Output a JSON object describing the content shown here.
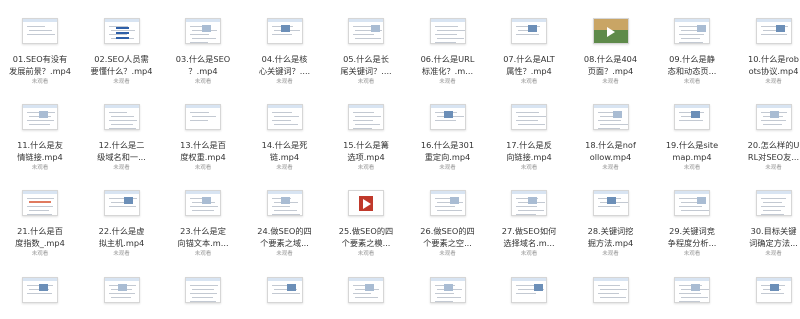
{
  "colors": {
    "title_text": "#333333",
    "status_text": "#999999",
    "background": "#ffffff"
  },
  "status_label": "未观看",
  "files": [
    {
      "title": "01.SEO有没有发展前景？.mp4",
      "title_lines": [
        "01.SEO有没有",
        "发展前景？.mp4"
      ],
      "icon": "document-thumbnail-icon"
    },
    {
      "title": "02.SEO人员需要懂什么？.mp4",
      "title_lines": [
        "02.SEO人员需",
        "要懂什么？.mp4"
      ],
      "icon": "document-thumbnail-icon"
    },
    {
      "title": "03.什么是SEO？.mp4",
      "title_lines": [
        "03.什么是SEO",
        "？.mp4"
      ],
      "icon": "webpage-thumbnail-icon"
    },
    {
      "title": "04.什么是核心关键词？....",
      "title_lines": [
        "04.什么是核",
        "心关键词？...."
      ],
      "icon": "webpage-thumbnail-icon"
    },
    {
      "title": "05.什么是长尾关键词？....",
      "title_lines": [
        "05.什么是长",
        "尾关键词？...."
      ],
      "icon": "webpage-thumbnail-icon"
    },
    {
      "title": "06.什么是URL标准化？.m...",
      "title_lines": [
        "06.什么是URL",
        "标准化？.m..."
      ],
      "icon": "document-thumbnail-icon"
    },
    {
      "title": "07.什么是ALT属性？.mp4",
      "title_lines": [
        "07.什么是ALT",
        "属性？.mp4"
      ],
      "icon": "webpage-thumbnail-icon"
    },
    {
      "title": "08.什么是404页面？.mp4",
      "title_lines": [
        "08.什么是404",
        "页面？.mp4"
      ],
      "icon": "video-thumbnail-icon"
    },
    {
      "title": "09.什么是静态和动态页...",
      "title_lines": [
        "09.什么是静",
        "态和动态页..."
      ],
      "icon": "webpage-thumbnail-icon"
    },
    {
      "title": "10.什么是robots协议.mp4",
      "title_lines": [
        "10.什么是rob",
        "ots协议.mp4"
      ],
      "icon": "webpage-thumbnail-icon"
    },
    {
      "title": "11.什么是友情链接.mp4",
      "title_lines": [
        "11.什么是友",
        "情链接.mp4"
      ],
      "icon": "webpage-thumbnail-icon"
    },
    {
      "title": "12.什么是二级域名和一...",
      "title_lines": [
        "12.什么是二",
        "级域名和一..."
      ],
      "icon": "document-thumbnail-icon"
    },
    {
      "title": "13.什么是百度权重.mp4",
      "title_lines": [
        "13.什么是百",
        "度权重.mp4"
      ],
      "icon": "document-thumbnail-icon"
    },
    {
      "title": "14.什么是死链.mp4",
      "title_lines": [
        "14.什么是死",
        "链.mp4"
      ],
      "icon": "document-thumbnail-icon"
    },
    {
      "title": "15.什么是篝选项.mp4",
      "title_lines": [
        "15.什么是篝",
        "选项.mp4"
      ],
      "icon": "document-thumbnail-icon"
    },
    {
      "title": "16.什么是301重定向.mp4",
      "title_lines": [
        "16.什么是301",
        "重定向.mp4"
      ],
      "icon": "webpage-thumbnail-icon"
    },
    {
      "title": "17.什么是反向链接.mp4",
      "title_lines": [
        "17.什么是反",
        "向链接.mp4"
      ],
      "icon": "document-thumbnail-icon"
    },
    {
      "title": "18.什么是nofollow.mp4",
      "title_lines": [
        "18.什么是nof",
        "ollow.mp4"
      ],
      "icon": "webpage-thumbnail-icon"
    },
    {
      "title": "19.什么是sitemap.mp4",
      "title_lines": [
        "19.什么是site",
        "map.mp4"
      ],
      "icon": "webpage-thumbnail-icon"
    },
    {
      "title": "20.怎么样的URL对SEO友...",
      "title_lines": [
        "20.怎么样的U",
        "RL对SEO友..."
      ],
      "icon": "webpage-thumbnail-icon"
    },
    {
      "title": "21.什么是百度指数_.mp4",
      "title_lines": [
        "21.什么是百",
        "度指数_.mp4"
      ],
      "icon": "chart-thumbnail-icon"
    },
    {
      "title": "22.什么是虚拟主机.mp4",
      "title_lines": [
        "22.什么是虚",
        "拟主机.mp4"
      ],
      "icon": "webpage-thumbnail-icon"
    },
    {
      "title": "23.什么是定向锚文本.m...",
      "title_lines": [
        "23.什么是定",
        "向锚文本.m..."
      ],
      "icon": "webpage-thumbnail-icon"
    },
    {
      "title": "24.做SEO的四个要素之域...",
      "title_lines": [
        "24.做SEO的四",
        "个要素之域..."
      ],
      "icon": "webpage-thumbnail-icon"
    },
    {
      "title": "25.做SEO的四个要素之模...",
      "title_lines": [
        "25.做SEO的四",
        "个要素之模..."
      ],
      "icon": "video-player-thumbnail-icon"
    },
    {
      "title": "26.做SEO的四个要素之空...",
      "title_lines": [
        "26.做SEO的四",
        "个要素之空..."
      ],
      "icon": "webpage-thumbnail-icon"
    },
    {
      "title": "27.做SEO如何选择域名.m...",
      "title_lines": [
        "27.做SEO如何",
        "选择域名.m..."
      ],
      "icon": "webpage-thumbnail-icon"
    },
    {
      "title": "28.关键词挖掘方法.mp4",
      "title_lines": [
        "28.关键词挖",
        "掘方法.mp4"
      ],
      "icon": "webpage-thumbnail-icon"
    },
    {
      "title": "29.关键词竞争程度分析...",
      "title_lines": [
        "29.关键词竞",
        "争程度分析..."
      ],
      "icon": "webpage-thumbnail-icon"
    },
    {
      "title": "30.目标关键词确定方法...",
      "title_lines": [
        "30.目标关键",
        "词确定方法..."
      ],
      "icon": "document-thumbnail-icon"
    },
    {
      "title": "",
      "title_lines": [],
      "icon": "webpage-thumbnail-icon"
    },
    {
      "title": "",
      "title_lines": [],
      "icon": "webpage-thumbnail-icon"
    },
    {
      "title": "",
      "title_lines": [],
      "icon": "document-thumbnail-icon"
    },
    {
      "title": "",
      "title_lines": [],
      "icon": "webpage-thumbnail-icon"
    },
    {
      "title": "",
      "title_lines": [],
      "icon": "webpage-thumbnail-icon"
    },
    {
      "title": "",
      "title_lines": [],
      "icon": "webpage-thumbnail-icon"
    },
    {
      "title": "",
      "title_lines": [],
      "icon": "webpage-thumbnail-icon"
    },
    {
      "title": "",
      "title_lines": [],
      "icon": "document-thumbnail-icon"
    },
    {
      "title": "",
      "title_lines": [],
      "icon": "webpage-thumbnail-icon"
    },
    {
      "title": "",
      "title_lines": [],
      "icon": "webpage-thumbnail-icon"
    }
  ]
}
